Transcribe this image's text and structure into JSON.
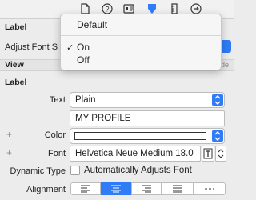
{
  "toolbar": {
    "icons": [
      "file-icon",
      "help-icon",
      "identity-icon",
      "attributes-icon",
      "size-ruler-icon",
      "connections-icon"
    ],
    "accent": "#2f7cf6"
  },
  "sections": {
    "label_title": "Label",
    "adjust_font_label": "Adjust Font S",
    "view_title": "View",
    "hide_label": "Hide",
    "label_sub_title": "Label"
  },
  "menu": {
    "items": [
      "Default",
      "On",
      "Off"
    ],
    "checked": "On"
  },
  "attributes": {
    "text_label": "Text",
    "text_type_value": "Plain",
    "text_value": "MY PROFILE",
    "color_label": "Color",
    "font_label": "Font",
    "font_value": "Helvetica Neue Medium 18.0",
    "dynamic_type_label": "Dynamic Type",
    "dynamic_type_checkbox_label": "Automatically Adjusts Font",
    "alignment_label": "Alignment"
  }
}
